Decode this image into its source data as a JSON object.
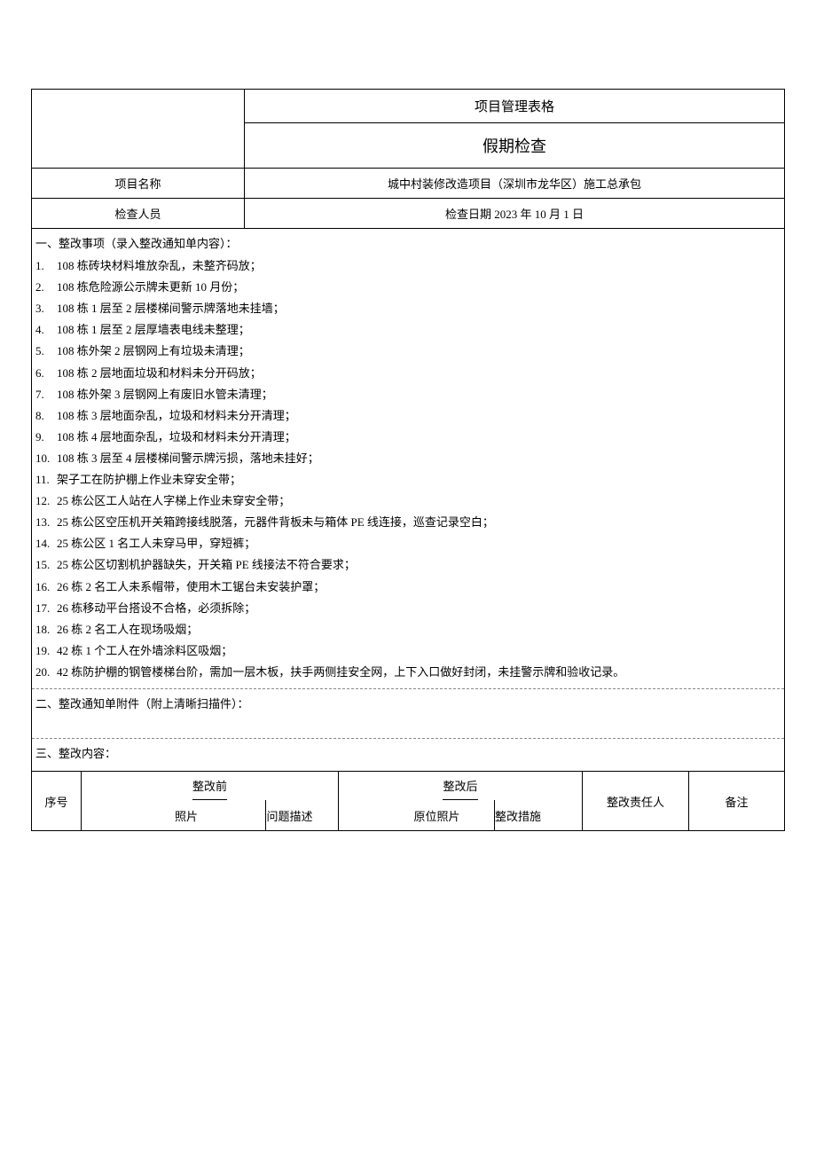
{
  "header": {
    "form_type": "项目管理表格",
    "title": "假期检查"
  },
  "info": {
    "project_label": "项目名称",
    "project_value": "城中村装修改造项目（深圳市龙华区）施工总承包",
    "inspector_label": "检查人员",
    "date_label_value": "检查日期 2023 年 10 月 1 日"
  },
  "section1": {
    "title": "一、整改事项（录入整改通知单内容）：",
    "items": [
      "108 栋砖块材料堆放杂乱，未整齐码放；",
      "108 栋危险源公示牌未更新 10 月份；",
      "108 栋 1 层至 2 层楼梯间警示牌落地未挂墙；",
      "108 栋 1 层至 2 层厚墙表电线未整理；",
      "108 栋外架 2 层钢网上有垃圾未清理；",
      "108 栋 2 层地面垃圾和材料未分开码放；",
      "108 栋外架 3 层钢网上有废旧水管未清理；",
      "108 栋 3 层地面杂乱，垃圾和材料未分开清理；",
      "108 栋 4 层地面杂乱，垃圾和材料未分开清理；",
      "108 栋 3 层至 4 层楼梯间警示牌污损，落地未挂好；",
      "架子工在防护棚上作业未穿安全带；",
      "25 栋公区工人站在人字梯上作业未穿安全带；",
      "25 栋公区空压机开关箱跨接线脱落，元器件背板未与箱体 PE 线连接，巡查记录空白；",
      "25 栋公区 1 名工人未穿马甲，穿短裤；",
      "25 栋公区切割机护器缺失，开关箱 PE 线接法不符合要求；",
      "26 栋 2 名工人未系帽带，使用木工锯台未安装护罩；",
      "26 栋移动平台搭设不合格，必须拆除；",
      "26 栋 2 名工人在现场吸烟；",
      "42 栋 1 个工人在外墙涂料区吸烟；",
      "42 栋防护棚的钢管楼梯台阶，需加一层木板，扶手两侧挂安全网，上下入口做好封闭，未挂警示牌和验收记录。"
    ]
  },
  "section2": {
    "title": "二、整改通知单附件（附上清晰扫描件）："
  },
  "section3": {
    "title": "三、整改内容："
  },
  "table2": {
    "seq": "序号",
    "before": "整改前",
    "after": "整改后",
    "person": "整改责任人",
    "note": "备注",
    "photo": "照片",
    "desc": "问题描述",
    "orig_photo": "原位照片",
    "measure": "整改措施"
  }
}
